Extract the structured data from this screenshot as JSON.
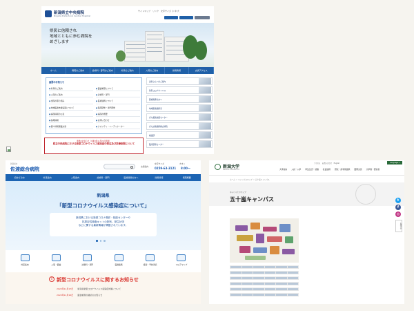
{
  "panel1": {
    "title": "新潟県立中央病院",
    "subtitle": "Niigata Prefectural Central Hospital",
    "top_links": "サイトマップ　リンク　文字サイズ 小 中 大",
    "hero_lines": [
      "県民に信頼され",
      "地域とともに歩む病院を",
      "めざします"
    ],
    "nav": [
      "ホーム",
      "病院のご案内",
      "診療科・部門のご案内",
      "外来のご案内",
      "入院のご案内",
      "採用情報",
      "交通アクセス"
    ],
    "main_title": "重要のお知らせ",
    "links": [
      "外来のご案内",
      "面会制限について",
      "入院のご案内",
      "診療科・部門",
      "当院の取り組み",
      "医療連携について",
      "地域医療支援病院について",
      "臨床研修・専門研修",
      "病院情報の公表",
      "病院の概要",
      "採用情報",
      "お問い合わせ",
      "個人情報保護方針",
      "クオリティ・インディケーター"
    ],
    "notice_small": "重要のお知らせ（令和3年11月24日更新）",
    "notice_main": "県立中央病院における新型コロナウイルス感染症の発生及び診療制限について",
    "side": [
      "患者さんへのご案内",
      "新型コロナウイルス",
      "医療関係の方へ",
      "地域医療連携室",
      "がん相談支援センター",
      "がん診療連携拠点病院",
      "看護部",
      "臨床研修センター",
      "病院事業のご案内",
      "内視鏡センター",
      "病院機能評価"
    ]
  },
  "panel2": {
    "logo_small": "新潟県立",
    "logo": "佐渡総合病院",
    "search_placeholder": "",
    "links": [
      "交通案内",
      "文字サイズ",
      "大きく"
    ],
    "phone": "0259-63-3121",
    "hours_label": "8:00〜",
    "nav": [
      "初めての方",
      "外来案内",
      "入院案内",
      "診療科・部門",
      "医療関係の方へ",
      "採用情報",
      "病院概要"
    ],
    "hero_pref": "新潟県",
    "hero_title": "「新型コロナウイルス感染症について」",
    "hero_lines": [
      "新潟県における新型コロナ受診・相談センターや",
      "抗原定性検査キットの配布、発生状況",
      "などに関する最新情報が掲載されています。"
    ],
    "quick": [
      "外来案内",
      "入院・面会",
      "診療科・部門",
      "医療連携",
      "検査・予約手続",
      "フロアマップ"
    ],
    "news_title": "新型コロナウイルスに関するお知らせ",
    "news": [
      {
        "date": "2022年11月17日",
        "text": "新潟県新型コロナウイルス感染症対策について"
      },
      {
        "date": "2022年11月16日",
        "text": "面会制限の継続のお知らせ"
      }
    ]
  },
  "panel3": {
    "uni_name": "新潟大学",
    "uni_sub": "NIIGATA UNIVERSITY",
    "top_links": "アクセス　お問い合わせ　English",
    "lang_label": "Language ▾",
    "nav": [
      "大学案内",
      "入試・入学",
      "学生生活・就職",
      "社会連携",
      "研究・産学官連携",
      "国際交流",
      "大学院・研究者"
    ],
    "crumb": "ホーム ＞ キャンパスマップ ＞ 五十嵐キャンパス",
    "eyebrow": "キャンパスマップ",
    "title": "五十嵐キャンパス",
    "side_tab": "お問合せ",
    "social": [
      {
        "name": "twitter-icon",
        "glyph": "t",
        "color": "#1da1f2"
      },
      {
        "name": "facebook-icon",
        "glyph": "f",
        "color": "#3b5998"
      },
      {
        "name": "instagram-icon",
        "glyph": "◎",
        "color": "#c13584"
      }
    ]
  }
}
